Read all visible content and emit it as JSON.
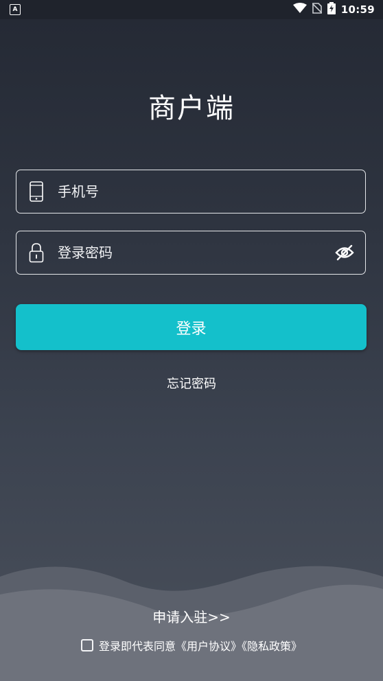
{
  "status_bar": {
    "notification_icon": "A",
    "time": "10:59",
    "icons": [
      "wifi-icon",
      "no-sim-icon",
      "battery-charging-icon"
    ]
  },
  "app": {
    "title": "商户端"
  },
  "login_form": {
    "phone_placeholder": "手机号",
    "password_placeholder": "登录密码",
    "phone_icon": "phone-icon",
    "lock_icon": "lock-icon",
    "eye_icon": "eye-off-icon",
    "login_label": "登录",
    "forgot_label": "忘记密码"
  },
  "footer": {
    "apply_label": "申请入驻>>",
    "agreement_text": "登录即代表同意《用户协议》《隐私政策》"
  },
  "colors": {
    "accent": "#14c0cb",
    "bg_top": "#242934",
    "bg_bottom": "#4a505b"
  }
}
